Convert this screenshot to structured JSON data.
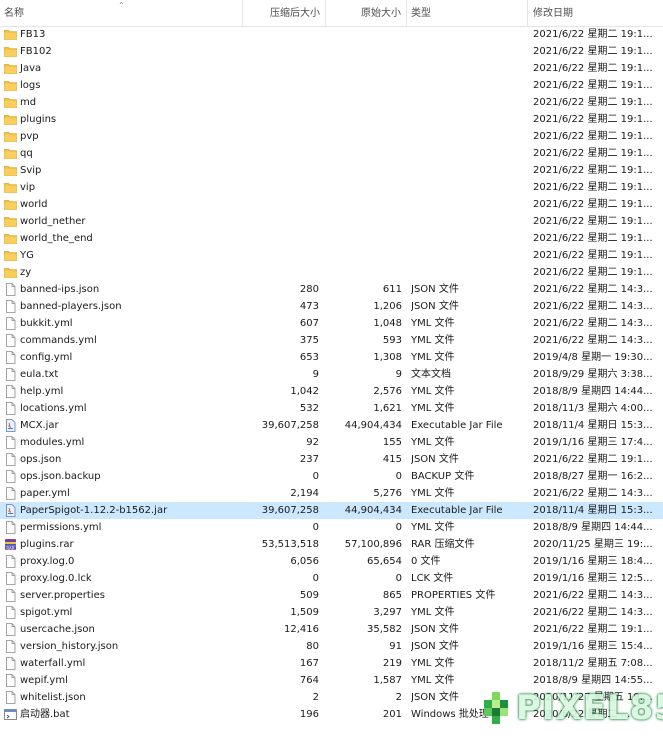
{
  "columns": {
    "name": "名称",
    "compressed": "压缩后大小",
    "original": "原始大小",
    "type": "类型",
    "modified": "修改日期"
  },
  "files": [
    {
      "name": "FB13",
      "compressed": "",
      "original": "",
      "type": "",
      "modified": "2021/6/22 星期二 19:1...",
      "icon": "folder-icon"
    },
    {
      "name": "FB102",
      "compressed": "",
      "original": "",
      "type": "",
      "modified": "2021/6/22 星期二 19:1...",
      "icon": "folder-icon"
    },
    {
      "name": "Java",
      "compressed": "",
      "original": "",
      "type": "",
      "modified": "2021/6/22 星期二 19:1...",
      "icon": "folder-icon"
    },
    {
      "name": "logs",
      "compressed": "",
      "original": "",
      "type": "",
      "modified": "2021/6/22 星期二 19:1...",
      "icon": "folder-icon"
    },
    {
      "name": "md",
      "compressed": "",
      "original": "",
      "type": "",
      "modified": "2021/6/22 星期二 19:1...",
      "icon": "folder-icon"
    },
    {
      "name": "plugins",
      "compressed": "",
      "original": "",
      "type": "",
      "modified": "2021/6/22 星期二 19:1...",
      "icon": "folder-icon"
    },
    {
      "name": "pvp",
      "compressed": "",
      "original": "",
      "type": "",
      "modified": "2021/6/22 星期二 19:1...",
      "icon": "folder-icon"
    },
    {
      "name": "qq",
      "compressed": "",
      "original": "",
      "type": "",
      "modified": "2021/6/22 星期二 19:1...",
      "icon": "folder-icon"
    },
    {
      "name": "Svip",
      "compressed": "",
      "original": "",
      "type": "",
      "modified": "2021/6/22 星期二 19:1...",
      "icon": "folder-icon"
    },
    {
      "name": "vip",
      "compressed": "",
      "original": "",
      "type": "",
      "modified": "2021/6/22 星期二 19:1...",
      "icon": "folder-icon"
    },
    {
      "name": "world",
      "compressed": "",
      "original": "",
      "type": "",
      "modified": "2021/6/22 星期二 19:1...",
      "icon": "folder-icon"
    },
    {
      "name": "world_nether",
      "compressed": "",
      "original": "",
      "type": "",
      "modified": "2021/6/22 星期二 19:1...",
      "icon": "folder-icon"
    },
    {
      "name": "world_the_end",
      "compressed": "",
      "original": "",
      "type": "",
      "modified": "2021/6/22 星期二 19:1...",
      "icon": "folder-icon"
    },
    {
      "name": "YG",
      "compressed": "",
      "original": "",
      "type": "",
      "modified": "2021/6/22 星期二 19:1...",
      "icon": "folder-icon"
    },
    {
      "name": "zy",
      "compressed": "",
      "original": "",
      "type": "",
      "modified": "2021/6/22 星期二 19:1...",
      "icon": "folder-icon"
    },
    {
      "name": "banned-ips.json",
      "compressed": "280",
      "original": "611",
      "type": "JSON 文件",
      "modified": "2021/6/22 星期二 14:3...",
      "icon": "file-icon"
    },
    {
      "name": "banned-players.json",
      "compressed": "473",
      "original": "1,206",
      "type": "JSON 文件",
      "modified": "2021/6/22 星期二 14:3...",
      "icon": "file-icon"
    },
    {
      "name": "bukkit.yml",
      "compressed": "607",
      "original": "1,048",
      "type": "YML 文件",
      "modified": "2021/6/22 星期二 14:3...",
      "icon": "file-icon"
    },
    {
      "name": "commands.yml",
      "compressed": "375",
      "original": "593",
      "type": "YML 文件",
      "modified": "2021/6/22 星期二 14:3...",
      "icon": "file-icon"
    },
    {
      "name": "config.yml",
      "compressed": "653",
      "original": "1,308",
      "type": "YML 文件",
      "modified": "2019/4/8 星期一 19:30...",
      "icon": "file-icon"
    },
    {
      "name": "eula.txt",
      "compressed": "9",
      "original": "9",
      "type": "文本文档",
      "modified": "2018/9/29 星期六 3:38...",
      "icon": "file-icon"
    },
    {
      "name": "help.yml",
      "compressed": "1,042",
      "original": "2,576",
      "type": "YML 文件",
      "modified": "2018/8/9 星期四 14:44...",
      "icon": "file-icon"
    },
    {
      "name": "locations.yml",
      "compressed": "532",
      "original": "1,621",
      "type": "YML 文件",
      "modified": "2018/11/3 星期六 4:00...",
      "icon": "file-icon"
    },
    {
      "name": "MCX.jar",
      "compressed": "39,607,258",
      "original": "44,904,434",
      "type": "Executable Jar File",
      "modified": "2018/11/4 星期日 15:3...",
      "icon": "jar-icon"
    },
    {
      "name": "modules.yml",
      "compressed": "92",
      "original": "155",
      "type": "YML 文件",
      "modified": "2019/1/16 星期三 17:4...",
      "icon": "file-icon"
    },
    {
      "name": "ops.json",
      "compressed": "237",
      "original": "415",
      "type": "JSON 文件",
      "modified": "2021/6/22 星期二 19:1...",
      "icon": "file-icon"
    },
    {
      "name": "ops.json.backup",
      "compressed": "0",
      "original": "0",
      "type": "BACKUP 文件",
      "modified": "2018/8/27 星期一 16:2...",
      "icon": "file-icon"
    },
    {
      "name": "paper.yml",
      "compressed": "2,194",
      "original": "5,276",
      "type": "YML 文件",
      "modified": "2021/6/22 星期二 14:3...",
      "icon": "file-icon"
    },
    {
      "name": "PaperSpigot-1.12.2-b1562.jar",
      "compressed": "39,607,258",
      "original": "44,904,434",
      "type": "Executable Jar File",
      "modified": "2018/11/4 星期日 15:3...",
      "icon": "jar-icon",
      "selected": true
    },
    {
      "name": "permissions.yml",
      "compressed": "0",
      "original": "0",
      "type": "YML 文件",
      "modified": "2018/8/9 星期四 14:44...",
      "icon": "file-icon"
    },
    {
      "name": "plugins.rar",
      "compressed": "53,513,518",
      "original": "57,100,896",
      "type": "RAR 压缩文件",
      "modified": "2020/11/25 星期三 19:...",
      "icon": "rar-icon"
    },
    {
      "name": "proxy.log.0",
      "compressed": "6,056",
      "original": "65,654",
      "type": "0 文件",
      "modified": "2019/1/16 星期三 18:4...",
      "icon": "file-icon"
    },
    {
      "name": "proxy.log.0.lck",
      "compressed": "0",
      "original": "0",
      "type": "LCK 文件",
      "modified": "2019/1/16 星期三 12:5...",
      "icon": "file-icon"
    },
    {
      "name": "server.properties",
      "compressed": "509",
      "original": "865",
      "type": "PROPERTIES 文件",
      "modified": "2021/6/22 星期二 14:3...",
      "icon": "file-icon"
    },
    {
      "name": "spigot.yml",
      "compressed": "1,509",
      "original": "3,297",
      "type": "YML 文件",
      "modified": "2021/6/22 星期二 14:3...",
      "icon": "file-icon"
    },
    {
      "name": "usercache.json",
      "compressed": "12,416",
      "original": "35,582",
      "type": "JSON 文件",
      "modified": "2021/6/22 星期二 19:1...",
      "icon": "file-icon"
    },
    {
      "name": "version_history.json",
      "compressed": "80",
      "original": "91",
      "type": "JSON 文件",
      "modified": "2019/1/16 星期三 15:4...",
      "icon": "file-icon"
    },
    {
      "name": "waterfall.yml",
      "compressed": "167",
      "original": "219",
      "type": "YML 文件",
      "modified": "2018/11/2 星期五 7:08...",
      "icon": "file-icon"
    },
    {
      "name": "wepif.yml",
      "compressed": "764",
      "original": "1,587",
      "type": "YML 文件",
      "modified": "2018/8/9 星期四 14:55...",
      "icon": "file-icon"
    },
    {
      "name": "whitelist.json",
      "compressed": "2",
      "original": "2",
      "type": "JSON 文件",
      "modified": "2020/11/27 星期五 19:...",
      "icon": "file-icon"
    },
    {
      "name": "启动器.bat",
      "compressed": "196",
      "original": "201",
      "type": "Windows 批处理",
      "modified": "2020/6/22 星期二 ...",
      "icon": "bat-icon"
    }
  ],
  "watermark": {
    "text": "PIXEL85"
  },
  "colors": {
    "selected_row": "#cce8ff",
    "folder": "#f5c342",
    "accent_blue": "#1a73d9"
  }
}
